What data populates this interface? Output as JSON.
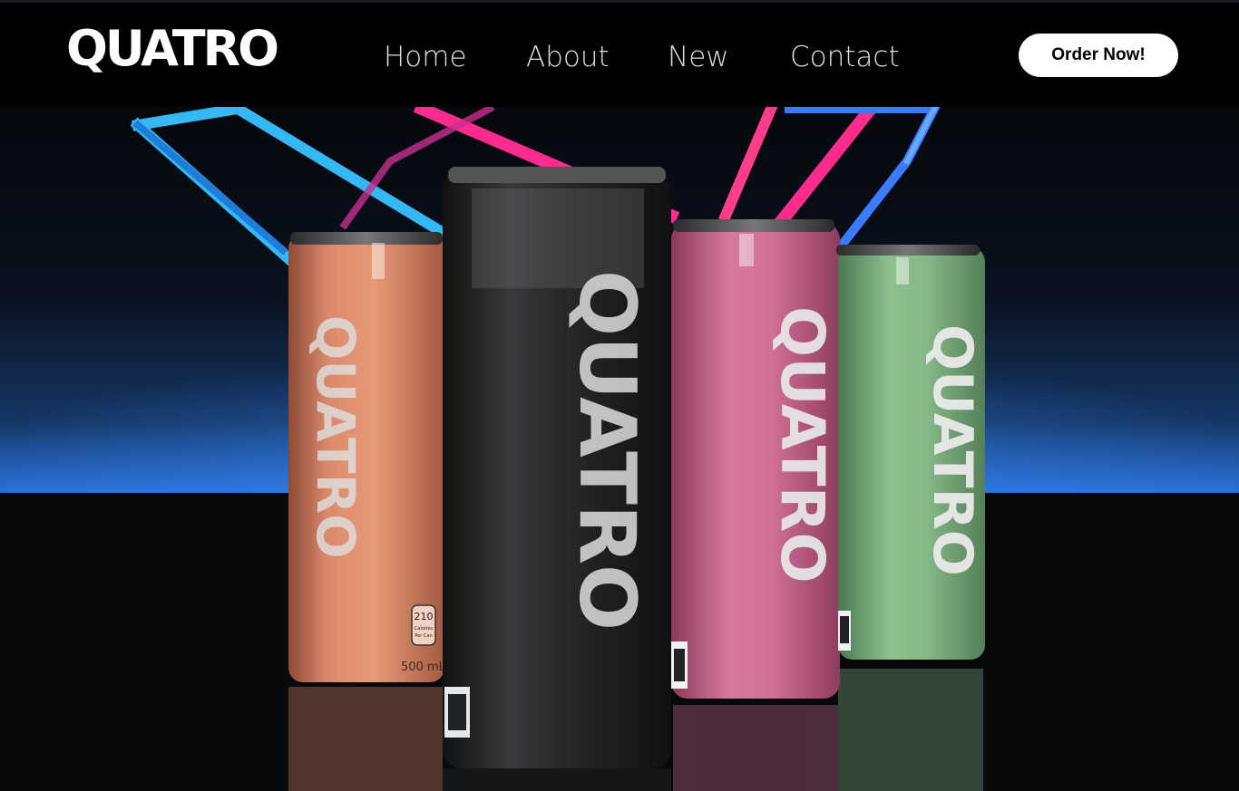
{
  "brand": {
    "logo_text": "QUATRO"
  },
  "nav": {
    "items": [
      {
        "label": "Home"
      },
      {
        "label": "About"
      },
      {
        "label": "New"
      },
      {
        "label": "Contact"
      }
    ]
  },
  "cta": {
    "order_label": "Order Now!"
  },
  "hero": {
    "can_brand": "QUATRO",
    "cans": [
      {
        "flavor_color": "#d98a6b",
        "label_calories": "210",
        "label_cal_unit": "Calories",
        "label_cal_note": "Per Can",
        "volume": "500 mL"
      },
      {
        "flavor_color": "#2a2a2c"
      },
      {
        "flavor_color": "#cf6f94"
      },
      {
        "flavor_color": "#86b888"
      }
    ],
    "colors": {
      "neon_blue": "#38b8ff",
      "neon_pink": "#ff2b8d",
      "floor_glow": "#2a7dff"
    }
  }
}
